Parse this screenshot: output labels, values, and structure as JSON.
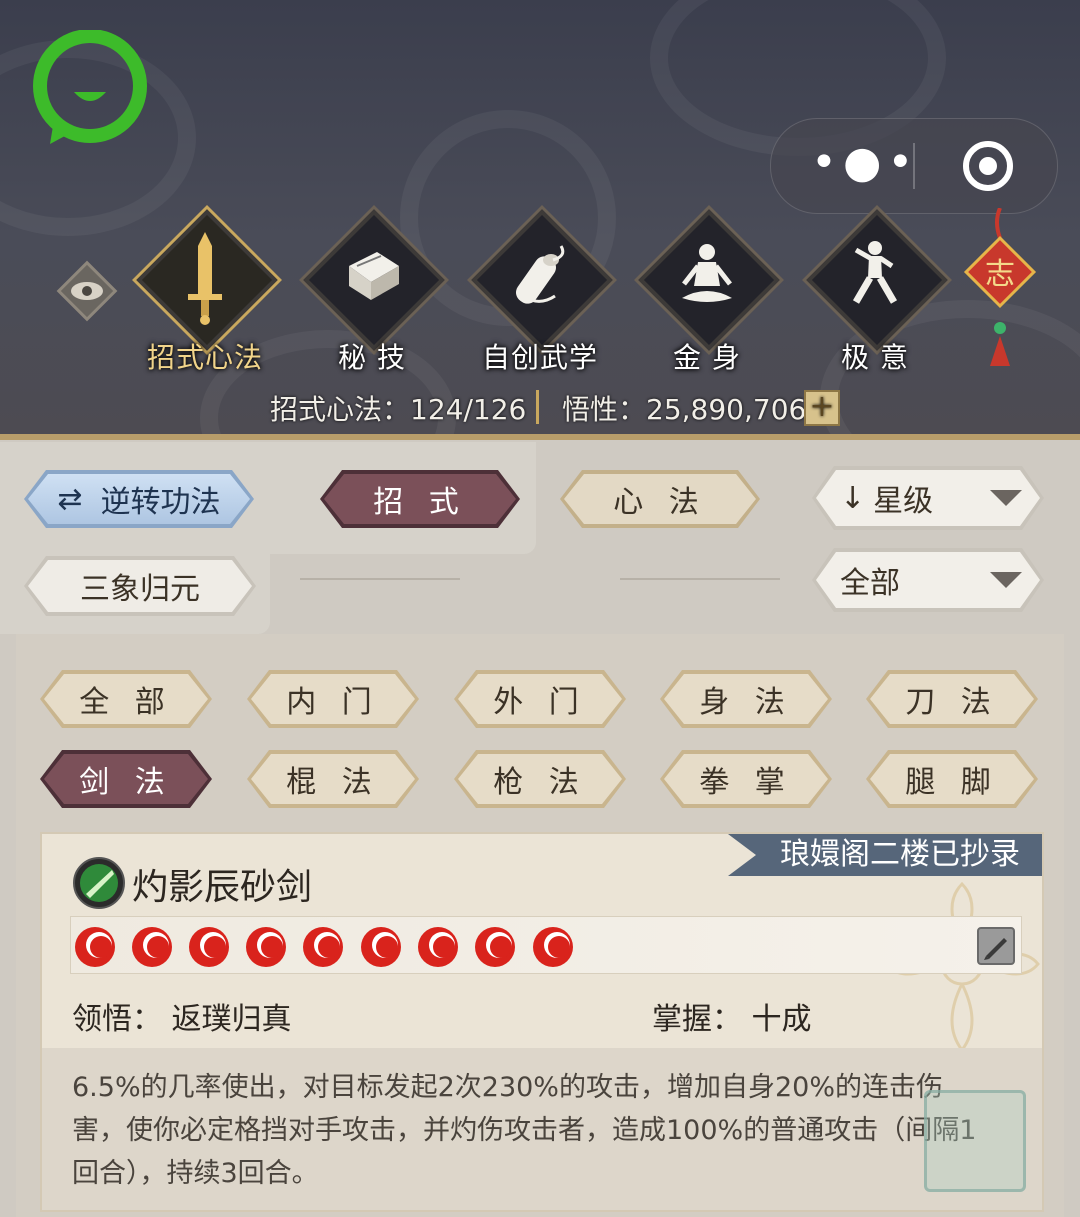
{
  "header": {
    "tabs": [
      {
        "label": "招式心法",
        "icon": "sword-icon",
        "active": true
      },
      {
        "label": "秘 技",
        "icon": "book-icon",
        "active": false
      },
      {
        "label": "自创武学",
        "icon": "scroll-icon",
        "active": false
      },
      {
        "label": "金 身",
        "icon": "meditation-icon",
        "active": false
      },
      {
        "label": "极 意",
        "icon": "martial-stance-icon",
        "active": false
      }
    ],
    "charm_text": "志",
    "stats": {
      "skills_label": "招式心法：124/126",
      "insight_label": "悟性：25,890,706",
      "plus": "+"
    }
  },
  "filters": {
    "reverse_label": "逆转功法",
    "zhaoshi_label": "招 式",
    "xinfa_label": "心 法",
    "sort_label": "星级",
    "sanxiang_label": "三象归元",
    "scope_label": "全部"
  },
  "categories": [
    {
      "label": "全 部",
      "active": false
    },
    {
      "label": "内 门",
      "active": false
    },
    {
      "label": "外 门",
      "active": false
    },
    {
      "label": "身 法",
      "active": false
    },
    {
      "label": "刀 法",
      "active": false
    },
    {
      "label": "剑 法",
      "active": true
    },
    {
      "label": "棍 法",
      "active": false
    },
    {
      "label": "枪 法",
      "active": false
    },
    {
      "label": "拳 掌",
      "active": false
    },
    {
      "label": "腿 脚",
      "active": false
    }
  ],
  "skill": {
    "ribbon": "琅嬛阁二楼已抄录",
    "name": "灼影辰砂剑",
    "orbs": 9,
    "comprehension": "领悟：  返璞归真",
    "mastery": "掌握：  十成",
    "description": "6.5%的几率使出，对目标发起2次230%的攻击，增加自身20%的连击伤害，使你必定格挡对手攻击，并灼伤攻击者，造成100%的普通攻击（间隔1回合），持续3回合。"
  },
  "colors": {
    "header_bg": "#3b3e4d",
    "gold": "#c9a85e",
    "active_tab": "#7b5059",
    "wechat_green": "#3dbb2a",
    "orb_red": "#d9231c"
  }
}
